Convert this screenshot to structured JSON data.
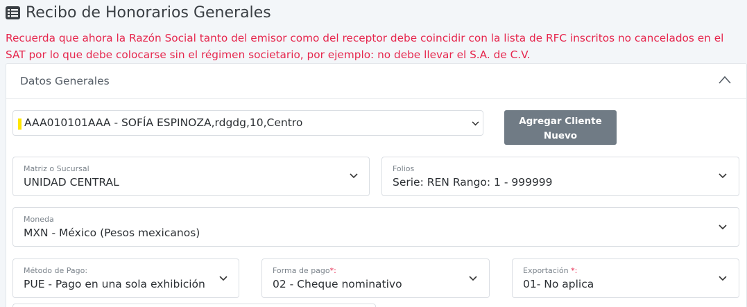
{
  "page": {
    "title": "Recibo de Honorarios Generales",
    "title_icon": "list-icon",
    "warning": "Recuerda que ahora la Razón Social tanto del emisor como del receptor debe coincidir con la lista de RFC inscritos no cancelados en el SAT por lo que debe colocarse sin el régimen societario, por ejemplo: no debe llevar el S.A. de C.V.",
    "warning_color": "#e6264d"
  },
  "card": {
    "title": "Datos Generales",
    "collapse_icon": "chevron-up-icon"
  },
  "client": {
    "value": "AAA010101AAA - SOFÍA ESPINOZA,rdgdg,10,Centro"
  },
  "add_client_button": {
    "label_line1": "Agregar Cliente",
    "label_line2": "Nuevo",
    "color": "#707b85"
  },
  "fields": {
    "matriz": {
      "label": "Matriz o Sucursal",
      "value": "UNIDAD CENTRAL"
    },
    "folios": {
      "label": "Folios",
      "value": "Serie: REN Rango: 1 - 999999"
    },
    "moneda": {
      "label": "Moneda",
      "value": "MXN - México (Pesos mexicanos)"
    },
    "metodo_pago": {
      "label": "Método de Pago:",
      "value": "PUE - Pago en una sola exhibición"
    },
    "forma_pago": {
      "label": "Forma de pago",
      "required_mark": "*:",
      "value": "02 - Cheque nominativo"
    },
    "exportacion": {
      "label": "Exportación",
      "required_mark": "*:",
      "value": "01- No aplica"
    }
  }
}
